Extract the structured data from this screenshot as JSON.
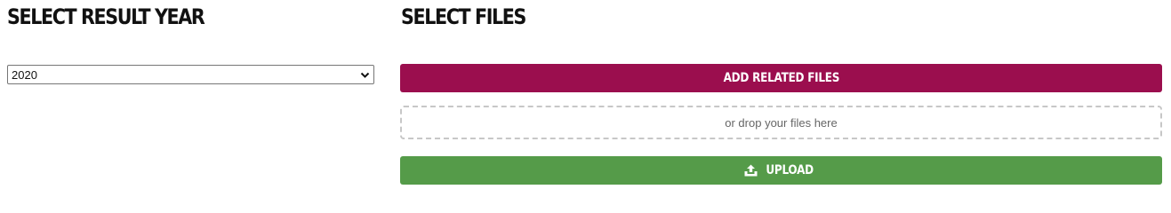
{
  "year_section": {
    "heading": "SELECT RESULT YEAR",
    "select": {
      "selected_value": "2020"
    }
  },
  "files_section": {
    "heading": "SELECT FILES",
    "add_button_label": "ADD RELATED FILES",
    "dropzone_text": "or drop your files here",
    "upload_button_label": "UPLOAD",
    "upload_icon": "upload-icon"
  },
  "colors": {
    "add_button": "#9b0e4e",
    "upload_button": "#559b49",
    "dropzone_border": "#c7c7c7"
  }
}
